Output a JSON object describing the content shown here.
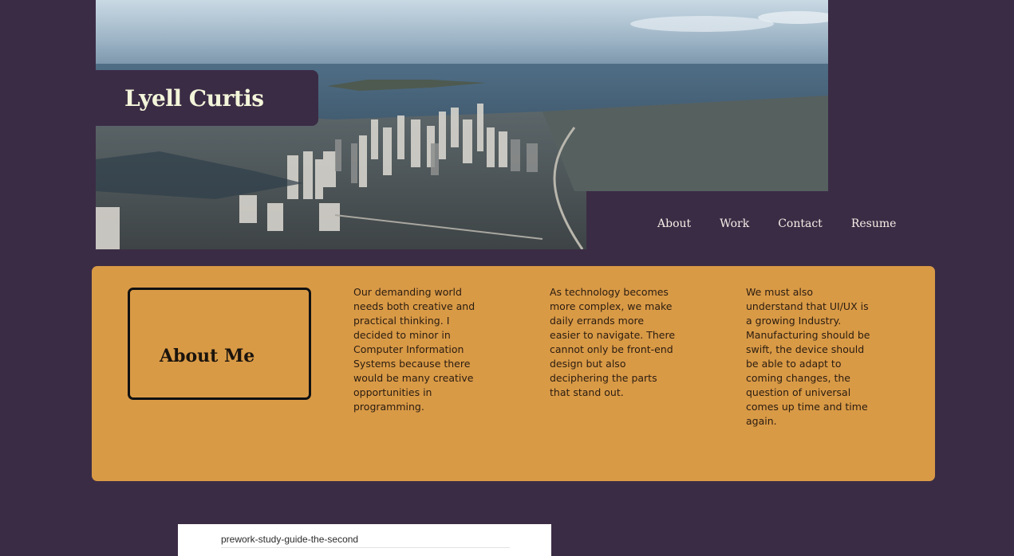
{
  "site": {
    "name": "Lyell Curtis"
  },
  "hero": {
    "image_name": "aerial-city-skyline-photo"
  },
  "nav": {
    "items": [
      {
        "label": "About"
      },
      {
        "label": "Work"
      },
      {
        "label": "Contact"
      },
      {
        "label": "Resume"
      }
    ]
  },
  "about": {
    "heading": "About Me",
    "paragraphs": [
      "Our demanding world needs both creative and practical thinking. I decided to minor in Computer Information Systems because there would be many creative opportunities in programming.",
      "As technology becomes more complex, we make daily errands more easier to navigate. There cannot only be front-end design but also deciphering the parts that stand out.",
      "We must also understand that UI/UX is a growing Industry. Manufacturing should be swift, the device should be able to adapt to coming changes, the question of universal comes up time and time again."
    ]
  },
  "work_preview": {
    "title": "prework-study-guide-the-second"
  },
  "colors": {
    "background": "#3b2c45",
    "about_panel": "#d99a46",
    "name_text": "#f3f6da"
  }
}
